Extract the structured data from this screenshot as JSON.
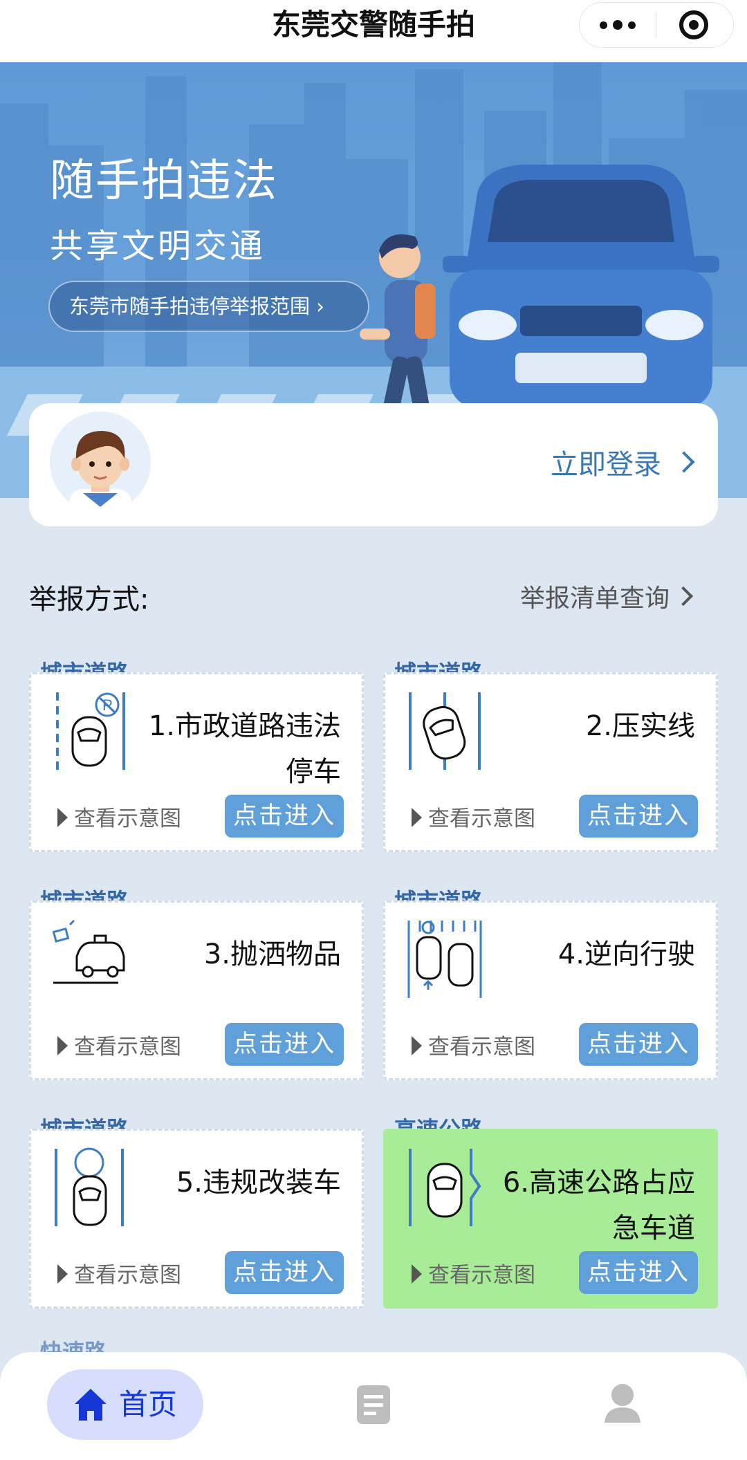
{
  "header": {
    "title": "东莞交警随手拍"
  },
  "hero": {
    "title": "随手拍违法",
    "subtitle": "共享文明交通",
    "scope_button": "东莞市随手拍违停举报范围"
  },
  "login": {
    "label": "立即登录"
  },
  "section": {
    "title": "举报方式:",
    "list_link": "举报清单查询"
  },
  "cards": [
    {
      "tag": "城市道路",
      "name": "1.市政道路违法停车",
      "view": "查看示意图",
      "enter": "点击进入",
      "icon": "parking-car-icon"
    },
    {
      "tag": "城市道路",
      "name": "2.压实线",
      "view": "查看示意图",
      "enter": "点击进入",
      "icon": "solid-line-car-icon"
    },
    {
      "tag": "城市道路",
      "name": "3.抛洒物品",
      "view": "查看示意图",
      "enter": "点击进入",
      "icon": "littering-car-icon"
    },
    {
      "tag": "城市道路",
      "name": "4.逆向行驶",
      "view": "查看示意图",
      "enter": "点击进入",
      "icon": "wrong-way-car-icon"
    },
    {
      "tag": "城市道路",
      "name": "5.违规改装车",
      "view": "查看示意图",
      "enter": "点击进入",
      "icon": "modified-car-icon"
    },
    {
      "tag": "高速公路",
      "name": "6.高速公路占应急车道",
      "view": "查看示意图",
      "enter": "点击进入",
      "icon": "emergency-lane-car-icon",
      "highlight": "#a9ec97"
    }
  ],
  "peek_tag": "快速路",
  "tabbar": {
    "home": "首页"
  },
  "colors": {
    "accent": "#5f9fda",
    "tag": "#3566a6",
    "home_active": "#1537d6",
    "highlight": "#a9ec97"
  }
}
